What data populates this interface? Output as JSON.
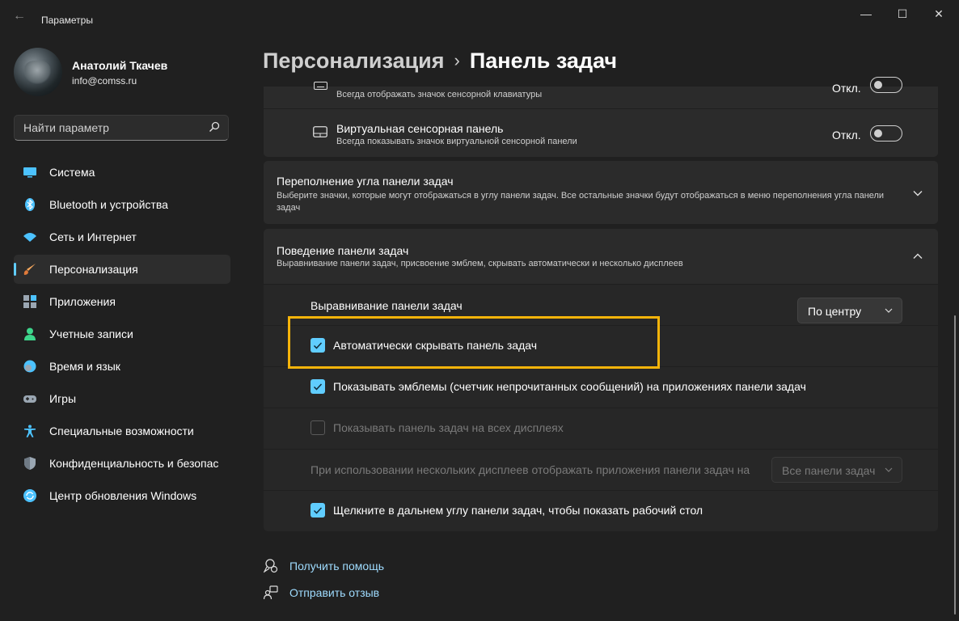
{
  "window": {
    "title": "Параметры",
    "back": "←",
    "minimize": "—",
    "maximize": "☐",
    "close": "✕"
  },
  "user": {
    "name": "Анатолий Ткачев",
    "email": "info@comss.ru"
  },
  "search": {
    "placeholder": "Найти параметр"
  },
  "nav": [
    {
      "label": "Система",
      "icon": "monitor-icon",
      "color": "#4cc2ff"
    },
    {
      "label": "Bluetooth и устройства",
      "icon": "bluetooth-icon",
      "color": "#4cc2ff"
    },
    {
      "label": "Сеть и Интернет",
      "icon": "wifi-icon",
      "color": "#4cc2ff"
    },
    {
      "label": "Персонализация",
      "icon": "brush-icon",
      "color": "#f7a85d",
      "active": true
    },
    {
      "label": "Приложения",
      "icon": "apps-icon",
      "color": "#9aa6b2"
    },
    {
      "label": "Учетные записи",
      "icon": "person-icon",
      "color": "#3dd68c"
    },
    {
      "label": "Время и язык",
      "icon": "globe-clock-icon",
      "color": "#4cc2ff"
    },
    {
      "label": "Игры",
      "icon": "gamepad-icon",
      "color": "#9aa6b2"
    },
    {
      "label": "Специальные возможности",
      "icon": "accessibility-icon",
      "color": "#4cc2ff"
    },
    {
      "label": "Конфиденциальность и безопас",
      "icon": "shield-icon",
      "color": "#9aa6b2"
    },
    {
      "label": "Центр обновления Windows",
      "icon": "update-icon",
      "color": "#4cc2ff"
    }
  ],
  "breadcrumb": {
    "parent": "Персонализация",
    "separator": "›",
    "current": "Панель задач"
  },
  "touch_keyboard": {
    "subtitle": "Всегда отображать значок сенсорной клавиатуры",
    "toggle_label": "Откл.",
    "on": false
  },
  "touchpad": {
    "title": "Виртуальная сенсорная панель",
    "subtitle": "Всегда показывать значок виртуальной сенсорной панели",
    "toggle_label": "Откл.",
    "on": false
  },
  "overflow": {
    "title": "Переполнение угла панели задач",
    "subtitle": "Выберите значки, которые могут отображаться в углу панели задач. Все остальные значки будут отображаться в меню переполнения угла панели задач"
  },
  "behavior": {
    "title": "Поведение панели задач",
    "subtitle": "Выравнивание панели задач, присвоение эмблем, скрывать автоматически и несколько дисплеев",
    "alignment_label": "Выравнивание панели задач",
    "alignment_value": "По центру",
    "autohide": {
      "label": "Автоматически скрывать панель задач",
      "checked": true
    },
    "badges": {
      "label": "Показывать эмблемы (счетчик непрочитанных сообщений) на приложениях панели задач",
      "checked": true
    },
    "all_displays": {
      "label": "Показывать панель задач на всех дисплеях",
      "checked": false,
      "disabled": true
    },
    "multi_display_label": "При использовании нескольких дисплеев отображать приложения панели задач на",
    "multi_display_value": "Все панели задач",
    "far_corner": {
      "label": "Щелкните в дальнем углу панели задач, чтобы показать рабочий стол",
      "checked": true
    }
  },
  "links": {
    "help": "Получить помощь",
    "feedback": "Отправить отзыв"
  },
  "colors": {
    "accent": "#60cdff",
    "highlight": "#f5b40a",
    "background": "#202020",
    "card": "#2b2b2b"
  }
}
